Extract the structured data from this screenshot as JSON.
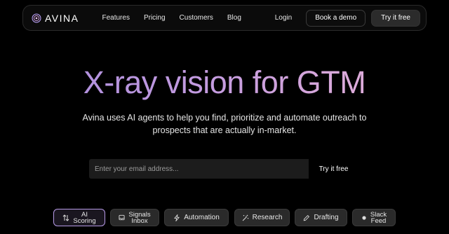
{
  "nav": {
    "logo_text": "AVINA",
    "links": [
      "Features",
      "Pricing",
      "Customers",
      "Blog"
    ],
    "login": "Login",
    "book_demo": "Book a demo",
    "try_free": "Try it free"
  },
  "hero": {
    "title": "X-ray vision for GTM",
    "subtitle": "Avina uses AI agents to help you find, prioritize and automate outreach to prospects that are actually in-market."
  },
  "signup": {
    "email_placeholder": "Enter your email address...",
    "button": "Try it free"
  },
  "chips": [
    {
      "label": "AI\nScoring",
      "icon": "sort-icon",
      "active": true
    },
    {
      "label": "Signals\nInbox",
      "icon": "inbox-icon",
      "active": false
    },
    {
      "label": "Automation",
      "icon": "lightning-icon",
      "active": false
    },
    {
      "label": "Research",
      "icon": "magic-wand-icon",
      "active": false
    },
    {
      "label": "Drafting",
      "icon": "pencil-icon",
      "active": false
    },
    {
      "label": "Slack\nFeed",
      "icon": "slack-icon",
      "active": false
    }
  ],
  "colors": {
    "accent_gradient_start": "#a78bdc",
    "accent_gradient_end": "#eab3d6",
    "active_chip_border": "#b69ae6"
  }
}
